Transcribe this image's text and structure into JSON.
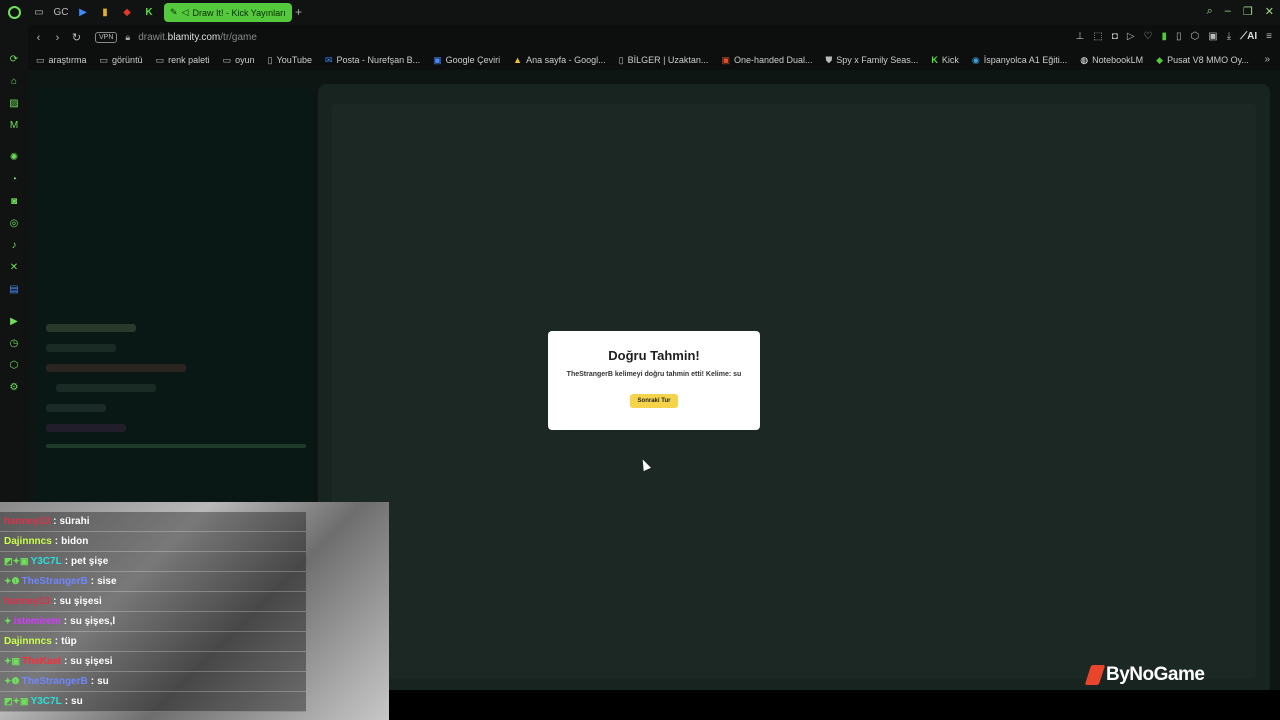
{
  "browser": {
    "active_tab_title": "Draw It! - Kick Yayınları",
    "url_prefix": "drawit.",
    "url_domain": "blamity.com",
    "url_path": "/tr/game",
    "vpn_label": "VPN",
    "ai_label": "AI",
    "tabbar_icons": [
      "ticket-icon",
      "GC",
      "play-icon",
      "bars-icon",
      "diamond-icon",
      "K"
    ]
  },
  "bookmarks": [
    {
      "label": "araştırma",
      "icon": "folder-icon"
    },
    {
      "label": "görüntü",
      "icon": "folder-icon"
    },
    {
      "label": "renk paleti",
      "icon": "folder-icon"
    },
    {
      "label": "oyun",
      "icon": "folder-icon"
    },
    {
      "label": "YouTube",
      "icon": "page-icon"
    },
    {
      "label": "Posta - Nurefşan B...",
      "icon": "mail-icon"
    },
    {
      "label": "Google Çeviri",
      "icon": "translate-icon"
    },
    {
      "label": "Ana sayfa - Googl...",
      "icon": "drive-icon"
    },
    {
      "label": "BİLGER | Uzaktan...",
      "icon": "page-icon"
    },
    {
      "label": "One-handed Dual...",
      "icon": "image-icon"
    },
    {
      "label": "Spy x Family Seas...",
      "icon": "shield-icon"
    },
    {
      "label": "Kick",
      "icon": "kick-icon"
    },
    {
      "label": "İspanyolca A1 Eğiti...",
      "icon": "globe-icon"
    },
    {
      "label": "NotebookLM",
      "icon": "notebook-icon"
    },
    {
      "label": "Pusat V8 MMO Oy...",
      "icon": "game-icon"
    }
  ],
  "modal": {
    "title": "Doğru Tahmin!",
    "message": "TheStrangerB kelimeyi doğru tahmin etti! Kelime: su",
    "button": "Sonraki Tur"
  },
  "chat": [
    {
      "user": "hanney13",
      "msg": "sürahi",
      "color": "#e0304a",
      "badges": ""
    },
    {
      "user": "Dajinnncs",
      "msg": "bidon",
      "color": "#c8ff4a",
      "badges": ""
    },
    {
      "user": "Y3C7L",
      "msg": "pet şişe",
      "color": "#28e0d8",
      "badges": "◩✦▣"
    },
    {
      "user": "TheStrangerB",
      "msg": "sise",
      "color": "#6f86ff",
      "badges": "✦❶"
    },
    {
      "user": "hanney13",
      "msg": "su şişesi",
      "color": "#e0304a",
      "badges": ""
    },
    {
      "user": "istemirem",
      "msg": "su şişes,l",
      "color": "#d23bff",
      "badges": "✦"
    },
    {
      "user": "Dajinnncs",
      "msg": "tüp",
      "color": "#c8ff4a",
      "badges": ""
    },
    {
      "user": "TheKael",
      "msg": "su şişesi",
      "color": "#ff2b3a",
      "badges": "✦▣"
    },
    {
      "user": "TheStrangerB",
      "msg": "su",
      "color": "#6f86ff",
      "badges": "✦❶"
    },
    {
      "user": "Y3C7L",
      "msg": "su",
      "color": "#28e0d8",
      "badges": "◩✦▣"
    }
  ],
  "watermark": "ByNoGame",
  "sidebar_icons": [
    "chatgpt-icon",
    "bag-icon",
    "wallet-icon",
    "music-icon",
    "openai-icon",
    "whatsapp-icon",
    "discord-icon",
    "instagram-icon",
    "tiktok-icon",
    "x-icon",
    "news-icon",
    "player-icon",
    "history-icon",
    "extensions-icon",
    "settings-icon"
  ],
  "colors": {
    "accent": "#55c93d",
    "modal_button": "#f5d34a"
  }
}
